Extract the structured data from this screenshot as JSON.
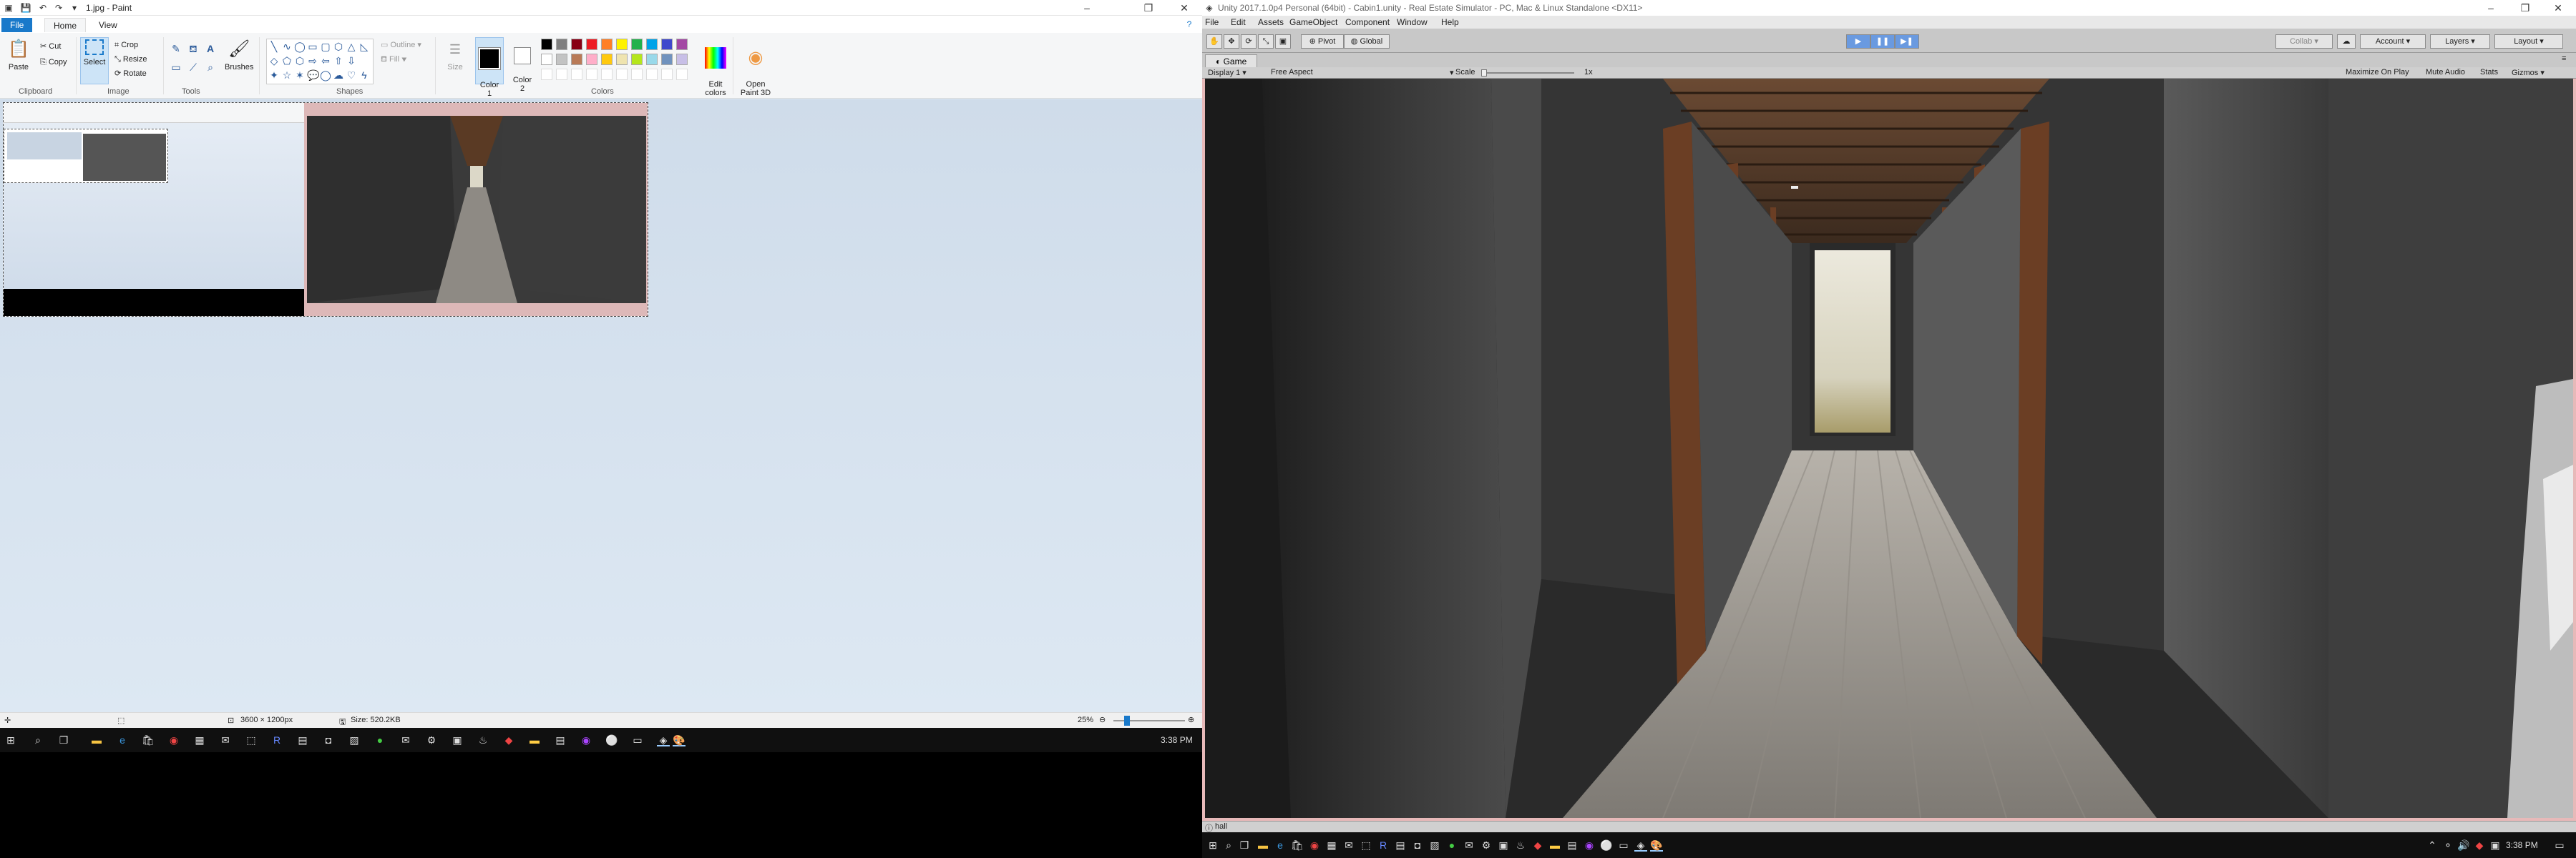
{
  "paint": {
    "title": "1.jpg - Paint",
    "quick_access": [
      "save-icon",
      "undo-icon",
      "redo-icon",
      "customize-icon"
    ],
    "tabs": [
      "File",
      "Home",
      "View"
    ],
    "clipboard": {
      "paste": "Paste",
      "cut": "Cut",
      "copy": "Copy",
      "label": "Clipboard"
    },
    "image": {
      "select": "Select",
      "crop": "Crop",
      "resize": "Resize",
      "rotate": "Rotate",
      "label": "Image"
    },
    "tools": {
      "label": "Tools"
    },
    "brushes": "Brushes",
    "shapes": {
      "outline": "Outline",
      "fill": "Fill",
      "label": "Shapes"
    },
    "size": "Size",
    "color1": "Color\n1",
    "color2": "Color\n2",
    "colors_label": "Colors",
    "edit_colors": "Edit\ncolors",
    "open_paint3d": "Open\nPaint 3D",
    "palette_row1": [
      "#000000",
      "#7f7f7f",
      "#880015",
      "#ed1c24",
      "#ff7f27",
      "#fff200",
      "#22b14c",
      "#00a2e8",
      "#3f48cc",
      "#a349a4"
    ],
    "palette_row2": [
      "#ffffff",
      "#c3c3c3",
      "#b97a57",
      "#ffaec9",
      "#ffc90e",
      "#efe4b0",
      "#b5e61d",
      "#99d9ea",
      "#7092be",
      "#c8bfe7"
    ],
    "status": {
      "dimensions": "3600 × 1200px",
      "size": "Size: 520.2KB",
      "zoom": "25%"
    }
  },
  "taskbar": {
    "time": "3:38 PM"
  },
  "unity": {
    "title": "Unity 2017.1.0p4 Personal (64bit) - Cabin1.unity - Real Estate Simulator - PC, Mac & Linux Standalone <DX11>",
    "menu": [
      "File",
      "Edit",
      "Assets",
      "GameObject",
      "Component",
      "Window",
      "Help"
    ],
    "pivot": "Pivot",
    "global": "Global",
    "collab": "Collab ▾",
    "account": "Account",
    "layers": "Layers",
    "layout": "Layout",
    "game_tab": "Game",
    "display": "Display 1",
    "aspect": "Free Aspect",
    "scale_label": "Scale",
    "scale_value": "1x",
    "maximize": "Maximize On Play",
    "mute": "Mute Audio",
    "stats": "Stats",
    "gizmos": "Gizmos",
    "console_text": "hall"
  },
  "taskbar_right": {
    "time": "3:38 PM"
  }
}
